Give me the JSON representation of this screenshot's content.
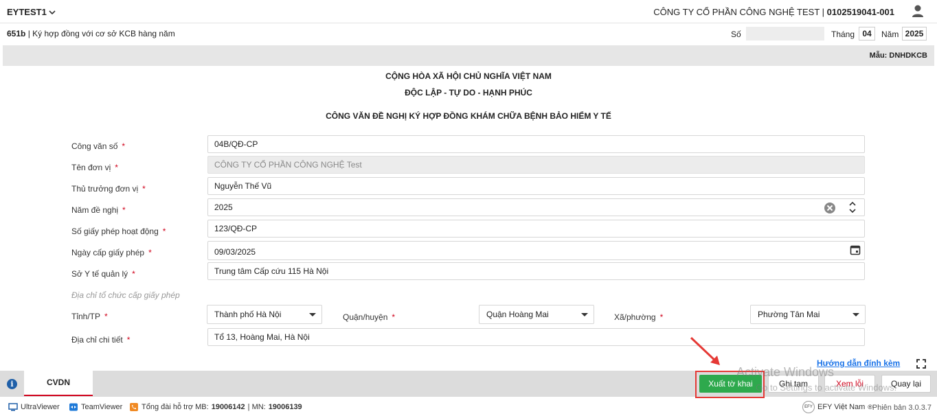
{
  "topbar": {
    "tenant": "EYTEST1",
    "company_name": "CÔNG TY CỔ PHẦN CÔNG NGHỆ TEST",
    "separator": "|",
    "company_code": "0102519041-001"
  },
  "formbar": {
    "form_code": "651b",
    "form_title": "Ký hợp đồng với cơ sở KCB hàng năm",
    "so_label": "Số",
    "so_value": "",
    "thang_label": "Tháng",
    "thang_value": "04",
    "nam_label": "Năm",
    "nam_value": "2025"
  },
  "template": {
    "mau_label": "Mẫu: DNHDKCB"
  },
  "document": {
    "header1": "CỘNG HÒA XÃ HỘI CHỦ NGHĨA VIỆT NAM",
    "header2": "ĐỘC LẬP - TỰ DO - HẠNH PHÚC",
    "header3": "CÔNG VĂN ĐỀ NGHỊ KÝ HỢP ĐỒNG KHÁM CHỮA BỆNH BẢO HIỂM Y TẾ",
    "required_mark": "*",
    "fields": {
      "cong_van_so": {
        "label": "Công văn số",
        "value": "04B/QĐ-CP"
      },
      "ten_don_vi": {
        "label": "Tên đơn vị",
        "value": "CÔNG TY CỔ PHẦN CÔNG NGHỆ Test"
      },
      "thu_truong": {
        "label": "Thủ trưởng đơn vị",
        "value": "Nguyễn Thế Vũ"
      },
      "nam_de_nghi": {
        "label": "Năm đề nghị",
        "value": "2025"
      },
      "so_giay_phep": {
        "label": "Số giấy phép hoạt động",
        "value": "123/QĐ-CP"
      },
      "ngay_cap": {
        "label": "Ngày cấp giấy phép",
        "value": "09/03/2025"
      },
      "so_y_te": {
        "label": "Sở Y tế quản lý",
        "value": "Trung tâm Cấp cứu 115 Hà Nội"
      }
    },
    "address_section_label": "Địa chỉ tổ chức cấp giấy phép",
    "tinh_tp": {
      "label": "Tỉnh/TP",
      "value": "Thành phố Hà Nội"
    },
    "quan_huyen": {
      "label": "Quận/huyện",
      "value": "Quận Hoàng Mai"
    },
    "xa_phuong": {
      "label": "Xã/phường",
      "value": "Phường Tân Mai"
    },
    "dia_chi": {
      "label": "Địa chỉ chi tiết",
      "value": "Tổ 13, Hoàng Mai, Hà Nội"
    },
    "guide_link": "Hướng dẫn đính kèm"
  },
  "bottombar": {
    "tab_label": "CVDN",
    "btn_export": "Xuất tờ khai",
    "btn_save_draft": "Ghi tạm",
    "btn_view_errors": "Xem lỗi",
    "btn_back": "Quay lại",
    "watermark_title": "Activate Windows",
    "watermark_sub": "Go to Settings to activate Windows."
  },
  "statusbar": {
    "ultraviewer": "UltraViewer",
    "teamviewer": "TeamViewer",
    "support_prefix": "Tổng đài hỗ trợ MB:",
    "support_mb": "19006142",
    "support_mid": "| MN:",
    "support_mn": "19006139",
    "brand": "EFY Việt Nam",
    "brand_reg": "®",
    "efy_logo_text": "EFY",
    "version": "Phiên bản 3.0.3.7"
  },
  "colors": {
    "primary_button": "#2ea94d",
    "required": "#d0021b",
    "link": "#1a73e8",
    "highlight": "#e53935"
  }
}
